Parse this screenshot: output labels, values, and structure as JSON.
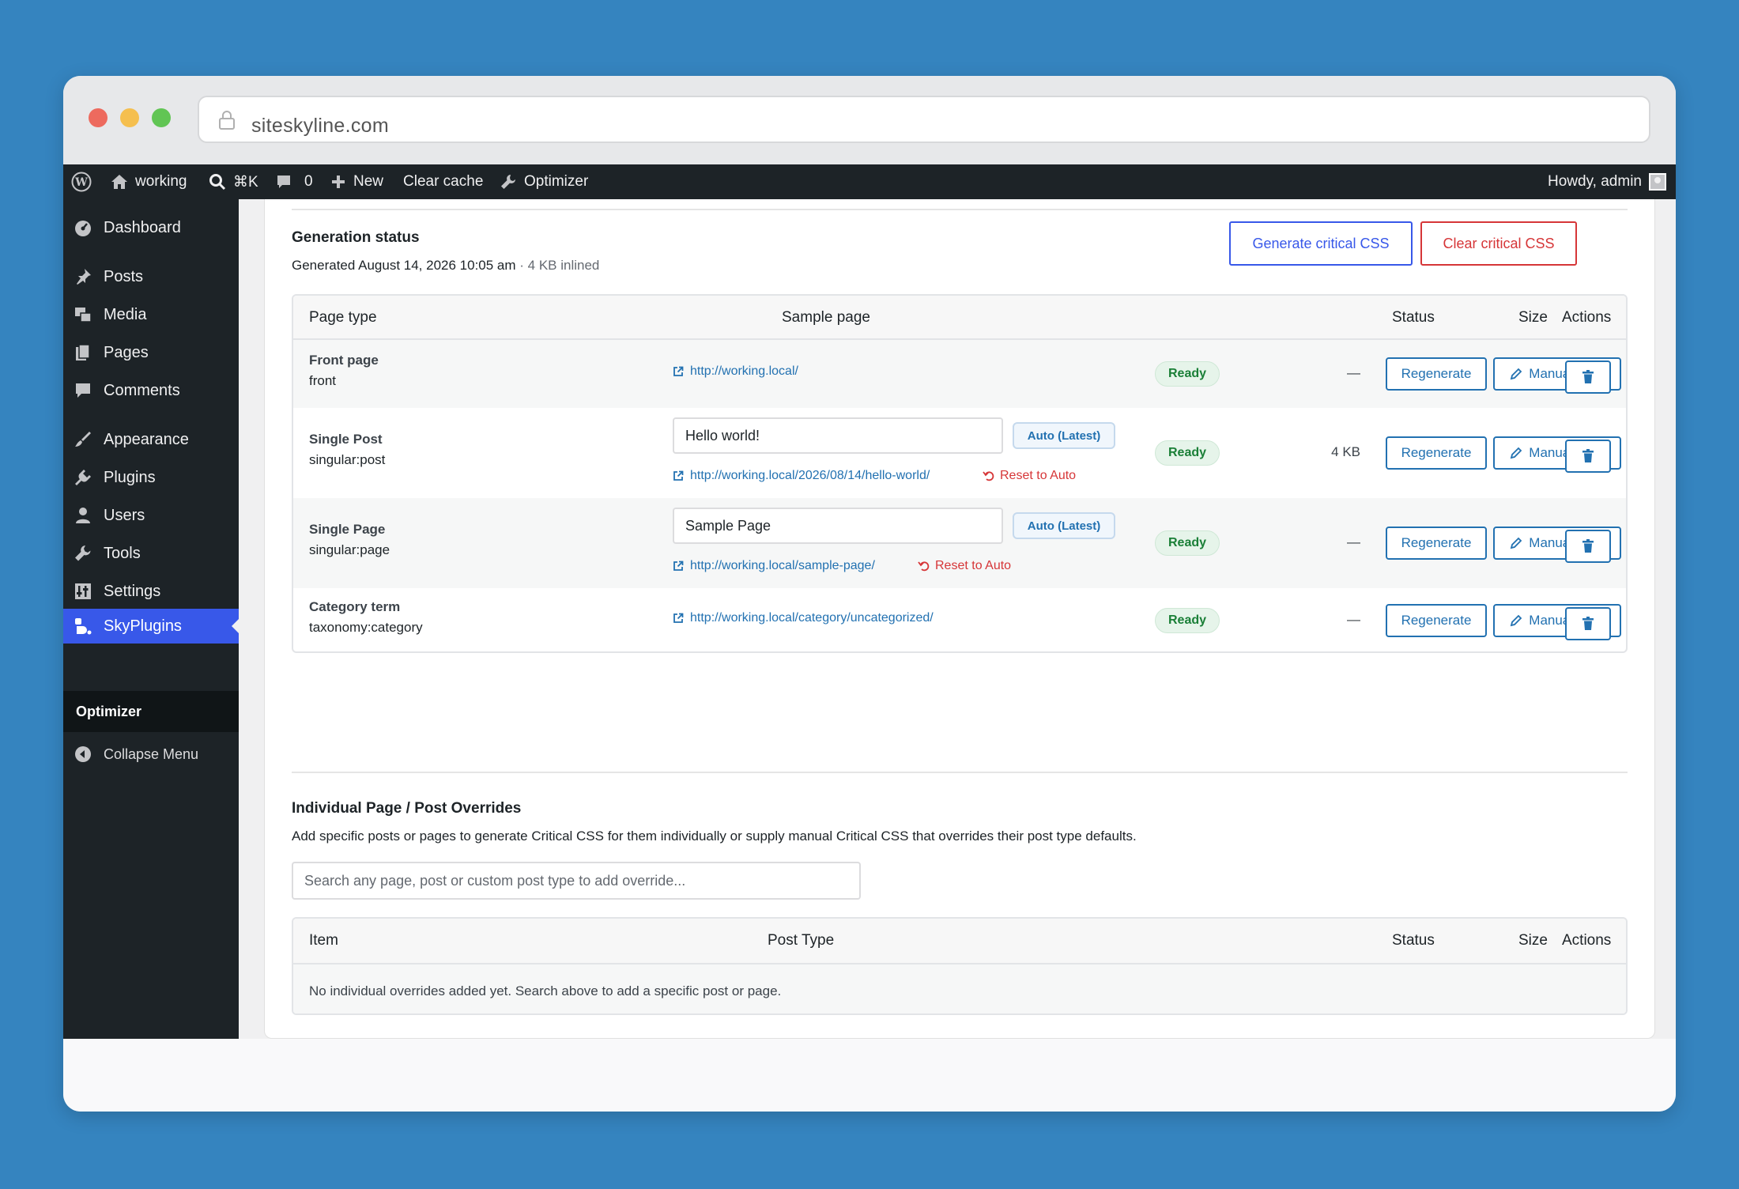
{
  "browser": {
    "url": "siteskyline.com"
  },
  "adminbar": {
    "site_name": "working",
    "search_shortcut": "⌘K",
    "comments_count": "0",
    "new_label": "New",
    "clear_cache": "Clear cache",
    "optimizer": "Optimizer",
    "howdy": "Howdy, admin"
  },
  "sidebar": {
    "items": [
      {
        "label": "Dashboard",
        "icon": "dashboard-icon"
      },
      {
        "label": "Posts",
        "icon": "pin-icon"
      },
      {
        "label": "Media",
        "icon": "media-icon"
      },
      {
        "label": "Pages",
        "icon": "pages-icon"
      },
      {
        "label": "Comments",
        "icon": "comment-icon"
      },
      {
        "label": "Appearance",
        "icon": "brush-icon"
      },
      {
        "label": "Plugins",
        "icon": "plugin-icon"
      },
      {
        "label": "Users",
        "icon": "user-icon"
      },
      {
        "label": "Tools",
        "icon": "wrench-icon"
      },
      {
        "label": "Settings",
        "icon": "settings-icon"
      },
      {
        "label": "SkyPlugins",
        "icon": "skyplugins-icon"
      }
    ],
    "submenu_current": "Optimizer",
    "collapse": "Collapse Menu"
  },
  "generation": {
    "title": "Generation status",
    "subtitle_main": "Generated August 14, 2026 10:05 am",
    "subtitle_extra": " · 4 KB inlined",
    "generate_button": "Generate critical CSS",
    "clear_button": "Clear critical CSS"
  },
  "table": {
    "headers": {
      "page_type": "Page type",
      "sample_page": "Sample page",
      "status": "Status",
      "size": "Size",
      "actions": "Actions"
    },
    "action_labels": {
      "regenerate": "Regenerate",
      "manual_css": "Manual CSS"
    },
    "rows": [
      {
        "name": "Front page",
        "key": "front",
        "link": "http://working.local/",
        "status": "Ready",
        "size": "—"
      },
      {
        "name": "Single Post",
        "key": "singular:post",
        "selected": "Hello world!",
        "badge": "Auto (Latest)",
        "link": "http://working.local/2026/08/14/hello-world/",
        "reset": "Reset to Auto",
        "status": "Ready",
        "size": "4 KB"
      },
      {
        "name": "Single Page",
        "key": "singular:page",
        "selected": "Sample Page",
        "badge": "Auto (Latest)",
        "link": "http://working.local/sample-page/",
        "reset": "Reset to Auto",
        "status": "Ready",
        "size": "—"
      },
      {
        "name": "Category term",
        "key": "taxonomy:category",
        "link": "http://working.local/category/uncategorized/",
        "status": "Ready",
        "size": "—"
      }
    ]
  },
  "overrides": {
    "title": "Individual Page / Post Overrides",
    "description": "Add specific posts or pages to generate Critical CSS for them individually or supply manual Critical CSS that overrides their post type defaults.",
    "search_placeholder": "Search any page, post or custom post type to add override...",
    "headers": {
      "item": "Item",
      "post_type": "Post Type",
      "status": "Status",
      "size": "Size",
      "actions": "Actions"
    },
    "empty": "No individual overrides added yet. Search above to add a specific post or page."
  },
  "colors": {
    "accent": "#3858e9",
    "link": "#2271b1",
    "danger": "#d63638",
    "ready": "#1a7f37",
    "adminbar": "#1d2327"
  }
}
